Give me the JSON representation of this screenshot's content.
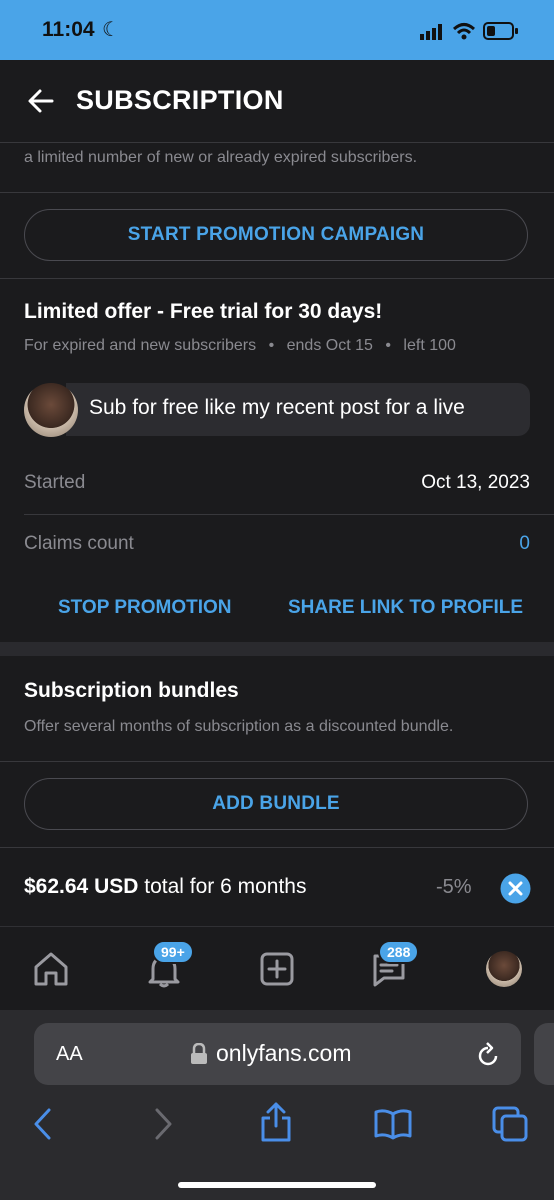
{
  "status_bar": {
    "time": "11:04"
  },
  "header": {
    "title": "SUBSCRIPTION"
  },
  "promo": {
    "truncated_text": "a limited number of new or already expired subscribers.",
    "start_button": "START PROMOTION CAMPAIGN"
  },
  "offer": {
    "title": "Limited offer - Free trial for 30 days!",
    "meta_audience": "For expired and new subscribers",
    "meta_ends": "ends Oct 15",
    "meta_left": "left 100",
    "message": "Sub for free like my recent post for a live",
    "started_label": "Started",
    "started_value": "Oct 13, 2023",
    "claims_label": "Claims count",
    "claims_value": "0",
    "stop_button": "STOP PROMOTION",
    "share_button": "SHARE LINK TO PROFILE"
  },
  "bundles": {
    "title": "Subscription bundles",
    "description": "Offer several months of subscription as a discounted bundle.",
    "add_button": "ADD BUNDLE",
    "bundle_price": "$62.64 USD",
    "bundle_text": " total for 6 months",
    "bundle_discount": "-5%"
  },
  "bottom_nav": {
    "notifications_badge": "99+",
    "messages_badge": "288"
  },
  "browser": {
    "aa_label": "AA",
    "url": "onlyfans.com"
  },
  "colors": {
    "accent": "#4aa4e8",
    "background": "#1b1b1d"
  },
  "icons": [
    "back-arrow-icon",
    "home-icon",
    "bell-icon",
    "add-post-icon",
    "messages-icon",
    "lock-icon",
    "reload-icon",
    "share-icon",
    "bookmarks-icon",
    "tabs-icon"
  ]
}
